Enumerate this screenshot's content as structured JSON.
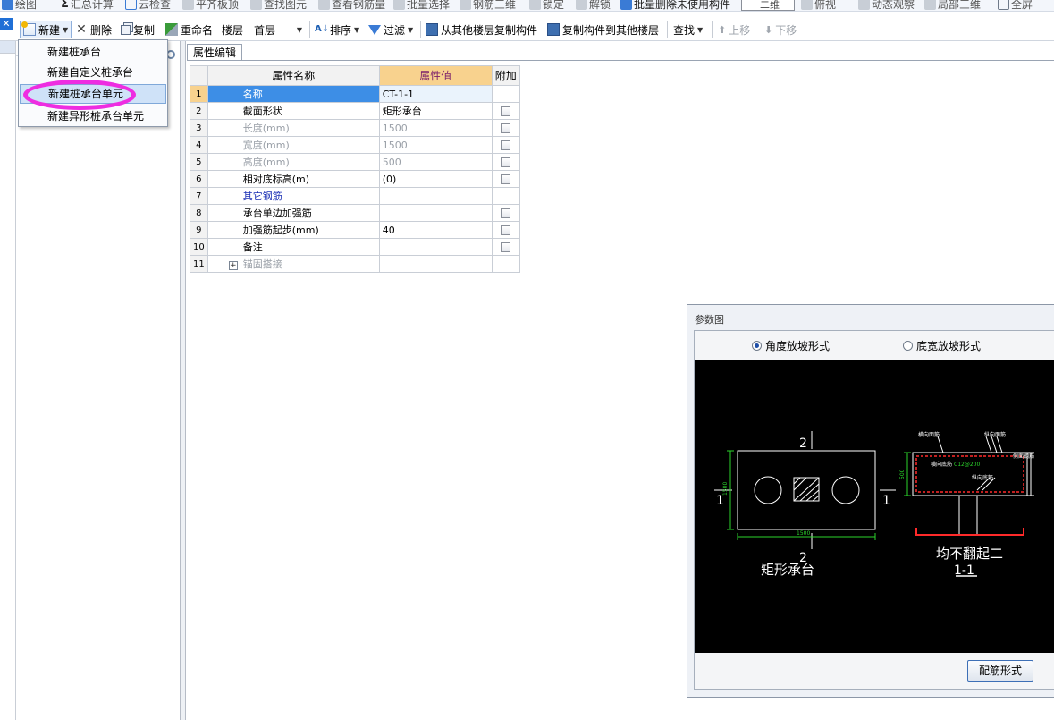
{
  "top_toolbar": {
    "items": [
      "绘图",
      "汇总计算",
      "云检查",
      "平齐板顶",
      "查找图元",
      "查看钢筋量",
      "批量选择",
      "钢筋三维",
      "锁定",
      "解锁",
      "批量删除未使用构件",
      "二维",
      "俯视",
      "动态观察",
      "局部三维",
      "全屏"
    ]
  },
  "toolbar": {
    "new_label": "新建",
    "delete_label": "删除",
    "copy_label": "复制",
    "rename_label": "重命名",
    "floor_label": "楼层",
    "floor_value": "首层",
    "sort_label": "排序",
    "filter_label": "过滤",
    "copy_from_floor_label": "从其他楼层复制构件",
    "copy_to_floor_label": "复制构件到其他楼层",
    "find_label": "查找",
    "move_up_label": "上移",
    "move_down_label": "下移"
  },
  "new_menu": {
    "items": [
      "新建桩承台",
      "新建自定义桩承台",
      "新建桩承台单元",
      "新建异形桩承台单元"
    ]
  },
  "properties": {
    "tab_label": "属性编辑",
    "headers": {
      "name": "属性名称",
      "value": "属性值",
      "extra": "附加"
    },
    "rows": [
      {
        "num": "1",
        "name": "名称",
        "value": "CT-1-1"
      },
      {
        "num": "2",
        "name": "截面形状",
        "value": "矩形承台"
      },
      {
        "num": "3",
        "name": "长度(mm)",
        "value": "1500"
      },
      {
        "num": "4",
        "name": "宽度(mm)",
        "value": "1500"
      },
      {
        "num": "5",
        "name": "高度(mm)",
        "value": "500"
      },
      {
        "num": "6",
        "name": "相对底标高(m)",
        "value": "(0)"
      },
      {
        "num": "7",
        "name": "其它钢筋",
        "value": ""
      },
      {
        "num": "8",
        "name": "承台单边加强筋",
        "value": ""
      },
      {
        "num": "9",
        "name": "加强筋起步(mm)",
        "value": "40"
      },
      {
        "num": "10",
        "name": "备注",
        "value": ""
      },
      {
        "num": "11",
        "name": "锚固搭接",
        "value": ""
      }
    ]
  },
  "param_window": {
    "title": "参数图",
    "radio_angle": "角度放坡形式",
    "radio_width": "底宽放坡形式",
    "rebar_button": "配筋形式",
    "cad": {
      "plan_caption": "矩形承台",
      "section_caption": "均不翻起二",
      "section_label": "1-1",
      "label_2": "2",
      "label_1": "1",
      "dim_1500": "1500",
      "dim_500": "500",
      "top_rebar_x": "横向面筋",
      "top_rebar_y": "纵向面筋",
      "bottom_rebar_x": "横向底筋",
      "bottom_rebar_value": "C12@200",
      "bottom_rebar_y": "纵向底筋",
      "side_rebar": "侧面钢筋"
    }
  },
  "colors": {
    "selection_blue": "#3d8ee6",
    "header_orange": "#f8d28e",
    "highlight_magenta": "#ee2de1",
    "cad_background": "#000000",
    "cad_rebar_red": "#ff2a2a",
    "cad_dim_green": "#2bd42b"
  }
}
